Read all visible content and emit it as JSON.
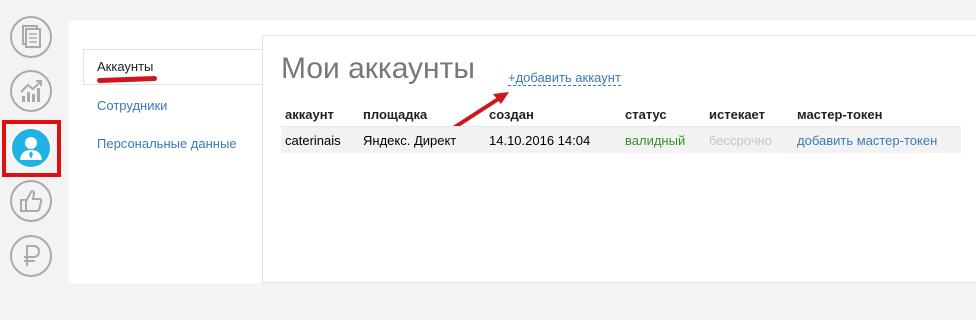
{
  "rail": {
    "icons": [
      "documents-icon",
      "chart-growth-icon",
      "user-profile-icon",
      "thumbs-up-icon",
      "ruble-icon"
    ],
    "active": "user-profile-icon",
    "accent_color": "#22b3e6",
    "highlight_color": "#e01010"
  },
  "subnav": {
    "items": [
      {
        "label": "Аккаунты"
      },
      {
        "label": "Сотрудники"
      },
      {
        "label": "Персональные данные"
      }
    ]
  },
  "main": {
    "title": "Мои аккаунты",
    "add_link": "+добавить аккаунт"
  },
  "table": {
    "headers": [
      "аккаунт",
      "площадка",
      "создан",
      "статус",
      "истекает",
      "мастер-токен"
    ],
    "rows": [
      {
        "account": "caterinais",
        "platform": "Яндекс. Директ",
        "created": "14.10.2016 14:04",
        "status": "валидный",
        "expires": "бессрочно",
        "master_token": "добавить мастер-токен"
      }
    ]
  }
}
